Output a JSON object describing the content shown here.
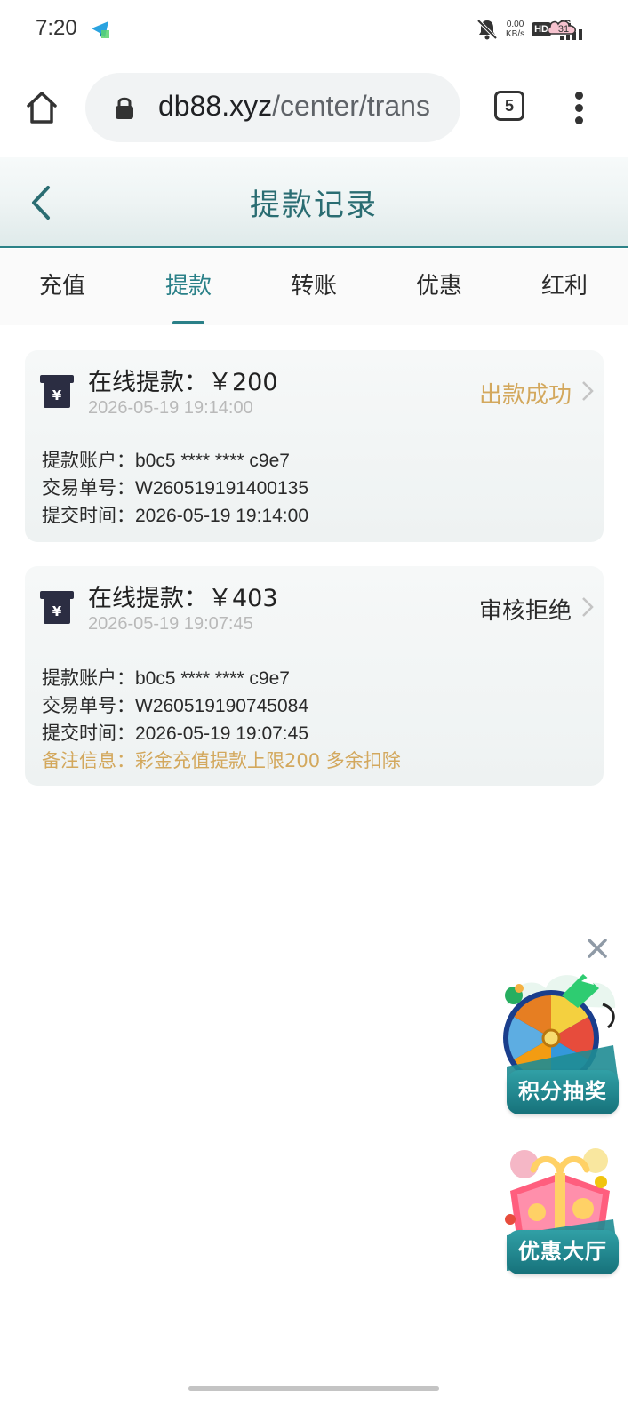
{
  "status_bar": {
    "time": "7:20",
    "net_speed_value": "0.00",
    "net_speed_unit": "KB/s",
    "hd_badge": "HD",
    "network_type": "4G",
    "battery_level": "31",
    "icons": [
      "telegram-icon",
      "mute-icon",
      "signal-icon",
      "battery-icon"
    ]
  },
  "browser": {
    "url_domain": "db88.xyz",
    "url_path": "/center/trans",
    "tab_count": "5"
  },
  "header": {
    "title": "提款记录"
  },
  "tabs": [
    {
      "label": "充值",
      "active": false
    },
    {
      "label": "提款",
      "active": true
    },
    {
      "label": "转账",
      "active": false
    },
    {
      "label": "优惠",
      "active": false
    },
    {
      "label": "红利",
      "active": false
    }
  ],
  "records": [
    {
      "title": "在线提款：￥200",
      "datetime": "2026-05-19 19:14:00",
      "status": "出款成功",
      "status_color": "#d3a85d",
      "account_label": "提款账户：",
      "account_value": "b0c5 **** **** c9e7",
      "order_label": "交易单号：",
      "order_value": "W260519191400135",
      "time_label": "提交时间：",
      "time_value": "2026-05-19 19:14:00"
    },
    {
      "title": "在线提款：￥403",
      "datetime": "2026-05-19 19:07:45",
      "status": "审核拒绝",
      "status_color": "#2a2a2a",
      "account_label": "提款账户：",
      "account_value": "b0c5 **** **** c9e7",
      "order_label": "交易单号：",
      "order_value": "W260519190745084",
      "time_label": "提交时间：",
      "time_value": "2026-05-19 19:07:45",
      "note_label": "备注信息：",
      "note_value": "彩金充值提款上限200 多余扣除"
    }
  ],
  "widgets": {
    "lottery_label": "积分抽奖",
    "promo_label": "优惠大厅"
  },
  "colors": {
    "accent": "#2a8088",
    "title": "#2a6d72",
    "success": "#d3a85d",
    "muted": "#b9b9b9"
  }
}
